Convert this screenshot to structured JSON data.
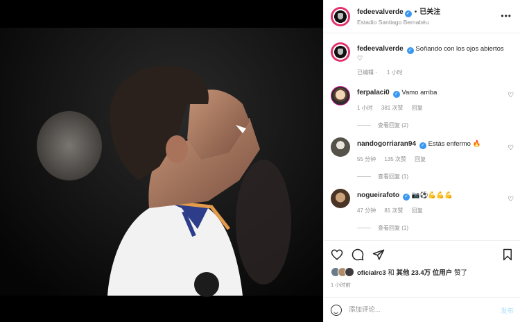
{
  "post": {
    "owner": "fedeevalverde",
    "follow_status": "已关注",
    "location": "Estadio Santiago Bernabéu",
    "more_icon": "more-horizontal-icon"
  },
  "caption": {
    "user": "fedeevalverde",
    "text": "Soñando con los ojos abiertos ♡",
    "edited": "已编辑",
    "time": "1 小时"
  },
  "comments": [
    {
      "user": "ferpalaci0",
      "text": "Vamo arriba",
      "time": "1 小时",
      "likes": "381 次赞",
      "reply": "回复",
      "view_replies": "查看回复 (2)"
    },
    {
      "user": "nandogorriaran94",
      "text": "Estás enfermo 🔥",
      "time": "55 分钟",
      "likes": "135 次赞",
      "reply": "回复",
      "view_replies": "查看回复 (1)"
    },
    {
      "user": "nogueirafoto",
      "text": "📷⚽💪💪💪",
      "time": "47 分钟",
      "likes": "81 次赞",
      "reply": "回复",
      "view_replies": "查看回复 (1)"
    }
  ],
  "likes": {
    "user": "oficialrc3",
    "and": "和",
    "others": "其他 23.4万 位用户",
    "suffix": "赞了"
  },
  "post_time": "1 小时前",
  "add_comment": {
    "placeholder": "添加评论...",
    "post_label": "发布"
  },
  "colors": {
    "verified": "#3897f0",
    "muted": "#8e8e8e",
    "post_disabled": "#b2dffc"
  }
}
